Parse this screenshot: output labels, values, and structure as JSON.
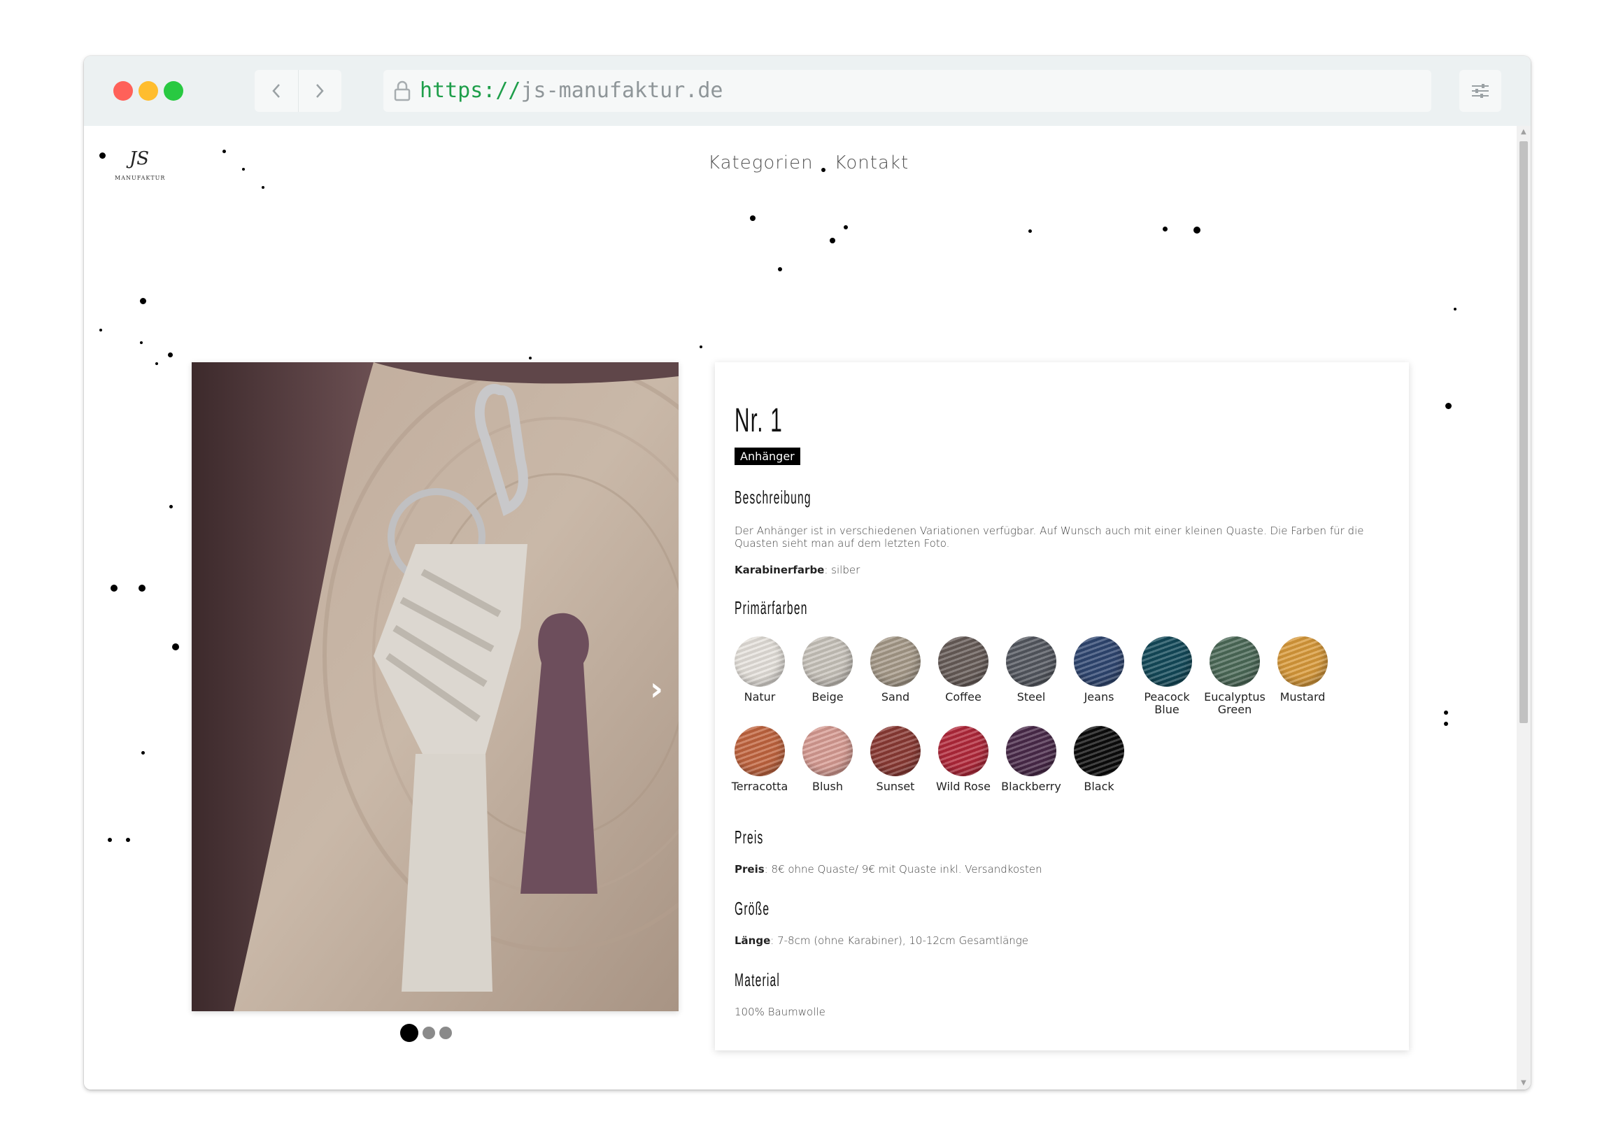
{
  "browser": {
    "url_scheme": "https://",
    "url_host": "js-manufaktur.de"
  },
  "site": {
    "logo_text": "JS",
    "logo_sub": "MANUFAKTUR",
    "nav": [
      "Kategorien",
      "Kontakt"
    ]
  },
  "product": {
    "title": "Nr. 1",
    "badge": "Anhänger",
    "description_heading": "Beschreibung",
    "description": "Der Anhänger ist in verschiedenen Variationen verfügbar. Auf Wunsch auch mit einer kleinen Quaste. Die Farben für die Quasten sieht man auf dem letzten Foto.",
    "clasp_label": "Karabinerfarbe",
    "clasp_value": ": silber",
    "colors_heading": "Primärfarben",
    "colors": [
      {
        "name": "Natur",
        "hex": "#e6e2dc"
      },
      {
        "name": "Beige",
        "hex": "#c9c4bc"
      },
      {
        "name": "Sand",
        "hex": "#a69a89"
      },
      {
        "name": "Coffee",
        "hex": "#675c58"
      },
      {
        "name": "Steel",
        "hex": "#545860"
      },
      {
        "name": "Jeans",
        "hex": "#2f4671"
      },
      {
        "name": "Peacock Blue",
        "hex": "#134a5a"
      },
      {
        "name": "Eucalyptus Green",
        "hex": "#4c6a58"
      },
      {
        "name": "Mustard",
        "hex": "#d99a3a"
      },
      {
        "name": "Terracotta",
        "hex": "#c2653f"
      },
      {
        "name": "Blush",
        "hex": "#d89c93"
      },
      {
        "name": "Sunset",
        "hex": "#8b3a34"
      },
      {
        "name": "Wild Rose",
        "hex": "#b2283a"
      },
      {
        "name": "Blackberry",
        "hex": "#4a2a4a"
      },
      {
        "name": "Black",
        "hex": "#0c0c0c"
      }
    ],
    "price_heading": "Preis",
    "price_label": "Preis",
    "price_value": ": 8€ ohne Quaste/ 9€ mit Quaste inkl. Versandkosten",
    "size_heading": "Größe",
    "size_label": "Länge",
    "size_value": ": 7-8cm (ohne Karabiner), 10-12cm Gesamtlänge",
    "material_heading": "Material",
    "material_value": "100% Baumwolle"
  },
  "carousel": {
    "slides": 3,
    "active_slide": 1
  }
}
